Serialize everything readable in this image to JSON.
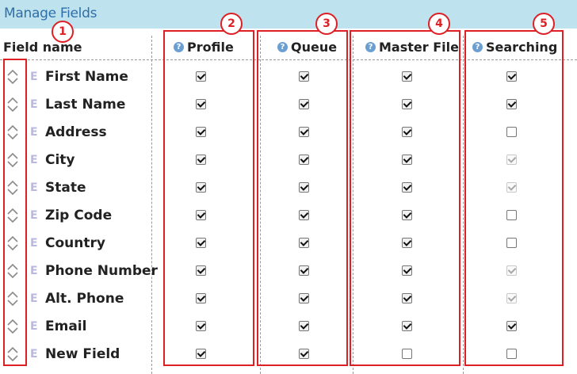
{
  "panel_title": "Manage Fields",
  "columns": {
    "field_name": "Field name",
    "profile": "Profile",
    "queue": "Queue",
    "master_file": "Master File",
    "searching": "Searching"
  },
  "help_icon": "question-circle-icon",
  "drag_icon": "diamond-chevron-icon",
  "field_type_marker": "E",
  "accent_color": "#dd1f26",
  "callouts": [
    "1",
    "2",
    "3",
    "4",
    "5"
  ],
  "fields": [
    {
      "name": "First Name",
      "profile": "checked",
      "queue": "checked",
      "master_file": "checked",
      "searching": "checked"
    },
    {
      "name": "Last Name",
      "profile": "checked",
      "queue": "checked",
      "master_file": "checked",
      "searching": "checked"
    },
    {
      "name": "Address",
      "profile": "checked",
      "queue": "checked",
      "master_file": "checked",
      "searching": "unchecked"
    },
    {
      "name": "City",
      "profile": "checked",
      "queue": "checked",
      "master_file": "checked",
      "searching": "checked-disabled"
    },
    {
      "name": "State",
      "profile": "checked",
      "queue": "checked",
      "master_file": "checked",
      "searching": "checked-disabled"
    },
    {
      "name": "Zip Code",
      "profile": "checked",
      "queue": "checked",
      "master_file": "checked",
      "searching": "unchecked"
    },
    {
      "name": "Country",
      "profile": "checked",
      "queue": "checked",
      "master_file": "checked",
      "searching": "unchecked"
    },
    {
      "name": "Phone Number",
      "profile": "checked",
      "queue": "checked",
      "master_file": "checked",
      "searching": "checked-disabled"
    },
    {
      "name": "Alt. Phone",
      "profile": "checked",
      "queue": "checked",
      "master_file": "checked",
      "searching": "checked-disabled"
    },
    {
      "name": "Email",
      "profile": "checked",
      "queue": "checked",
      "master_file": "checked",
      "searching": "checked"
    },
    {
      "name": "New Field",
      "profile": "checked",
      "queue": "checked",
      "master_file": "unchecked",
      "searching": "unchecked"
    }
  ]
}
